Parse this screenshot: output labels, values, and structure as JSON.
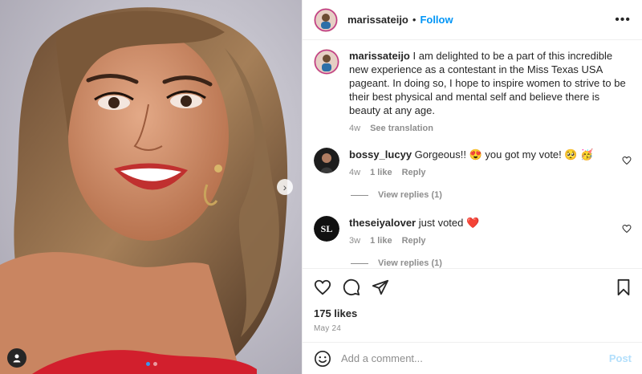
{
  "post": {
    "author": "marissateijo",
    "follow_label": "Follow",
    "separator": "•",
    "more_icon": "more-icon",
    "media": {
      "next_icon": "chevron-right-icon",
      "user_tag_icon": "user-icon",
      "slides": 2,
      "active_slide": 1
    }
  },
  "caption": {
    "username": "marissateijo",
    "text": "I am delighted to be a part of this incredible new experience as a contestant in the Miss Texas USA pageant. In doing so, I hope to inspire women to strive to be their best physical and mental self and believe there is beauty at any age.",
    "time": "4w",
    "translation_label": "See translation"
  },
  "comments": [
    {
      "username": "bossy_lucyy",
      "text": "Gorgeous!! 😍 you got my vote! 🥺 🥳",
      "time": "4w",
      "likes": "1 like",
      "reply_label": "Reply",
      "view_replies": "View replies (1)"
    },
    {
      "username": "theseiyalover",
      "text": "just voted ❤️",
      "avatar_text": "SL",
      "time": "3w",
      "likes": "1 like",
      "reply_label": "Reply",
      "view_replies": "View replies (1)"
    }
  ],
  "actions": {
    "like_icon": "heart-icon",
    "comment_icon": "comment-icon",
    "share_icon": "share-icon",
    "save_icon": "bookmark-icon",
    "likes_count": "175 likes",
    "date": "May 24"
  },
  "add_comment": {
    "emoji_icon": "emoji-icon",
    "placeholder": "Add a comment...",
    "post_label": "Post"
  },
  "colors": {
    "link_blue": "#0095f6",
    "muted": "#8e8e8e",
    "heart_red": "#ed4956",
    "post_disabled": "#b2dffc"
  }
}
